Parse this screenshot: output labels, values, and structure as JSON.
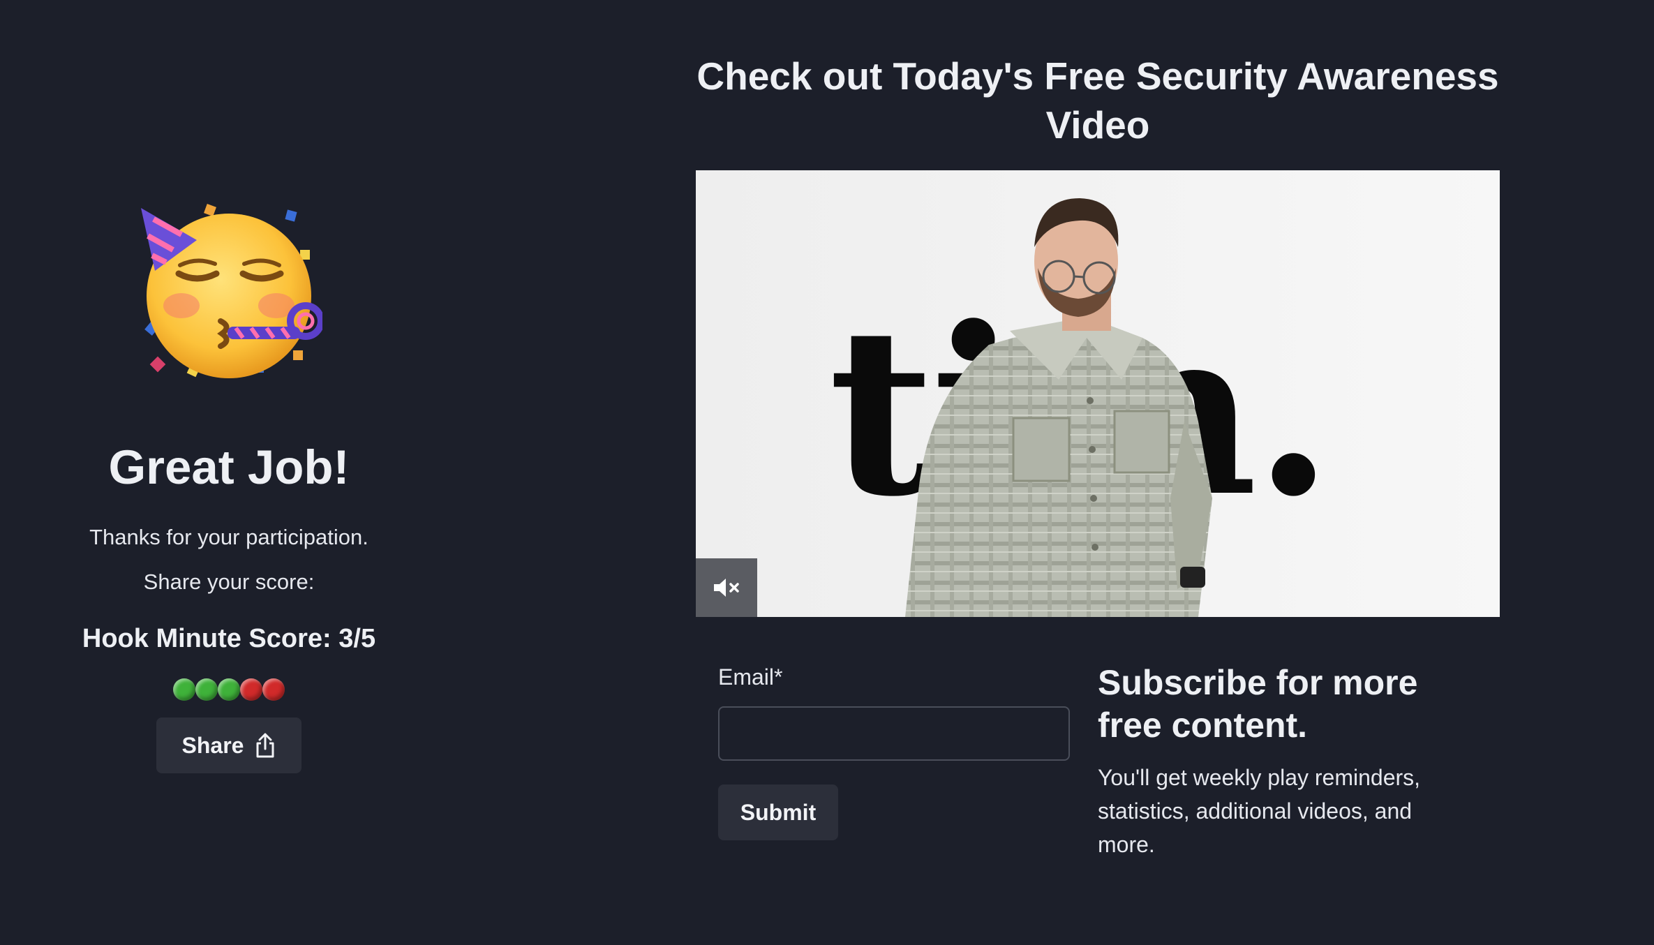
{
  "result": {
    "emoji": "partying-face",
    "heading": "Great Job!",
    "thanks": "Thanks for your participation.",
    "share_prompt": "Share your score:",
    "score_text": "Hook Minute Score: 3/5",
    "score_dots": [
      "correct",
      "correct",
      "correct",
      "wrong",
      "wrong"
    ],
    "share_button": "Share"
  },
  "video": {
    "title": "Check out Today's Free Security Awareness Video",
    "wordmark": "tim.",
    "mute_icon": "speaker-muted-icon"
  },
  "signup": {
    "email_label": "Email*",
    "email_value": "",
    "submit_label": "Submit",
    "title": "Subscribe for more free content.",
    "description": "You'll get weekly play reminders, statistics, additional videos, and more."
  },
  "colors": {
    "background": "#1c1f2a",
    "button": "#2c2f3a",
    "correct": "#3fb23a",
    "wrong": "#d12a2a"
  }
}
